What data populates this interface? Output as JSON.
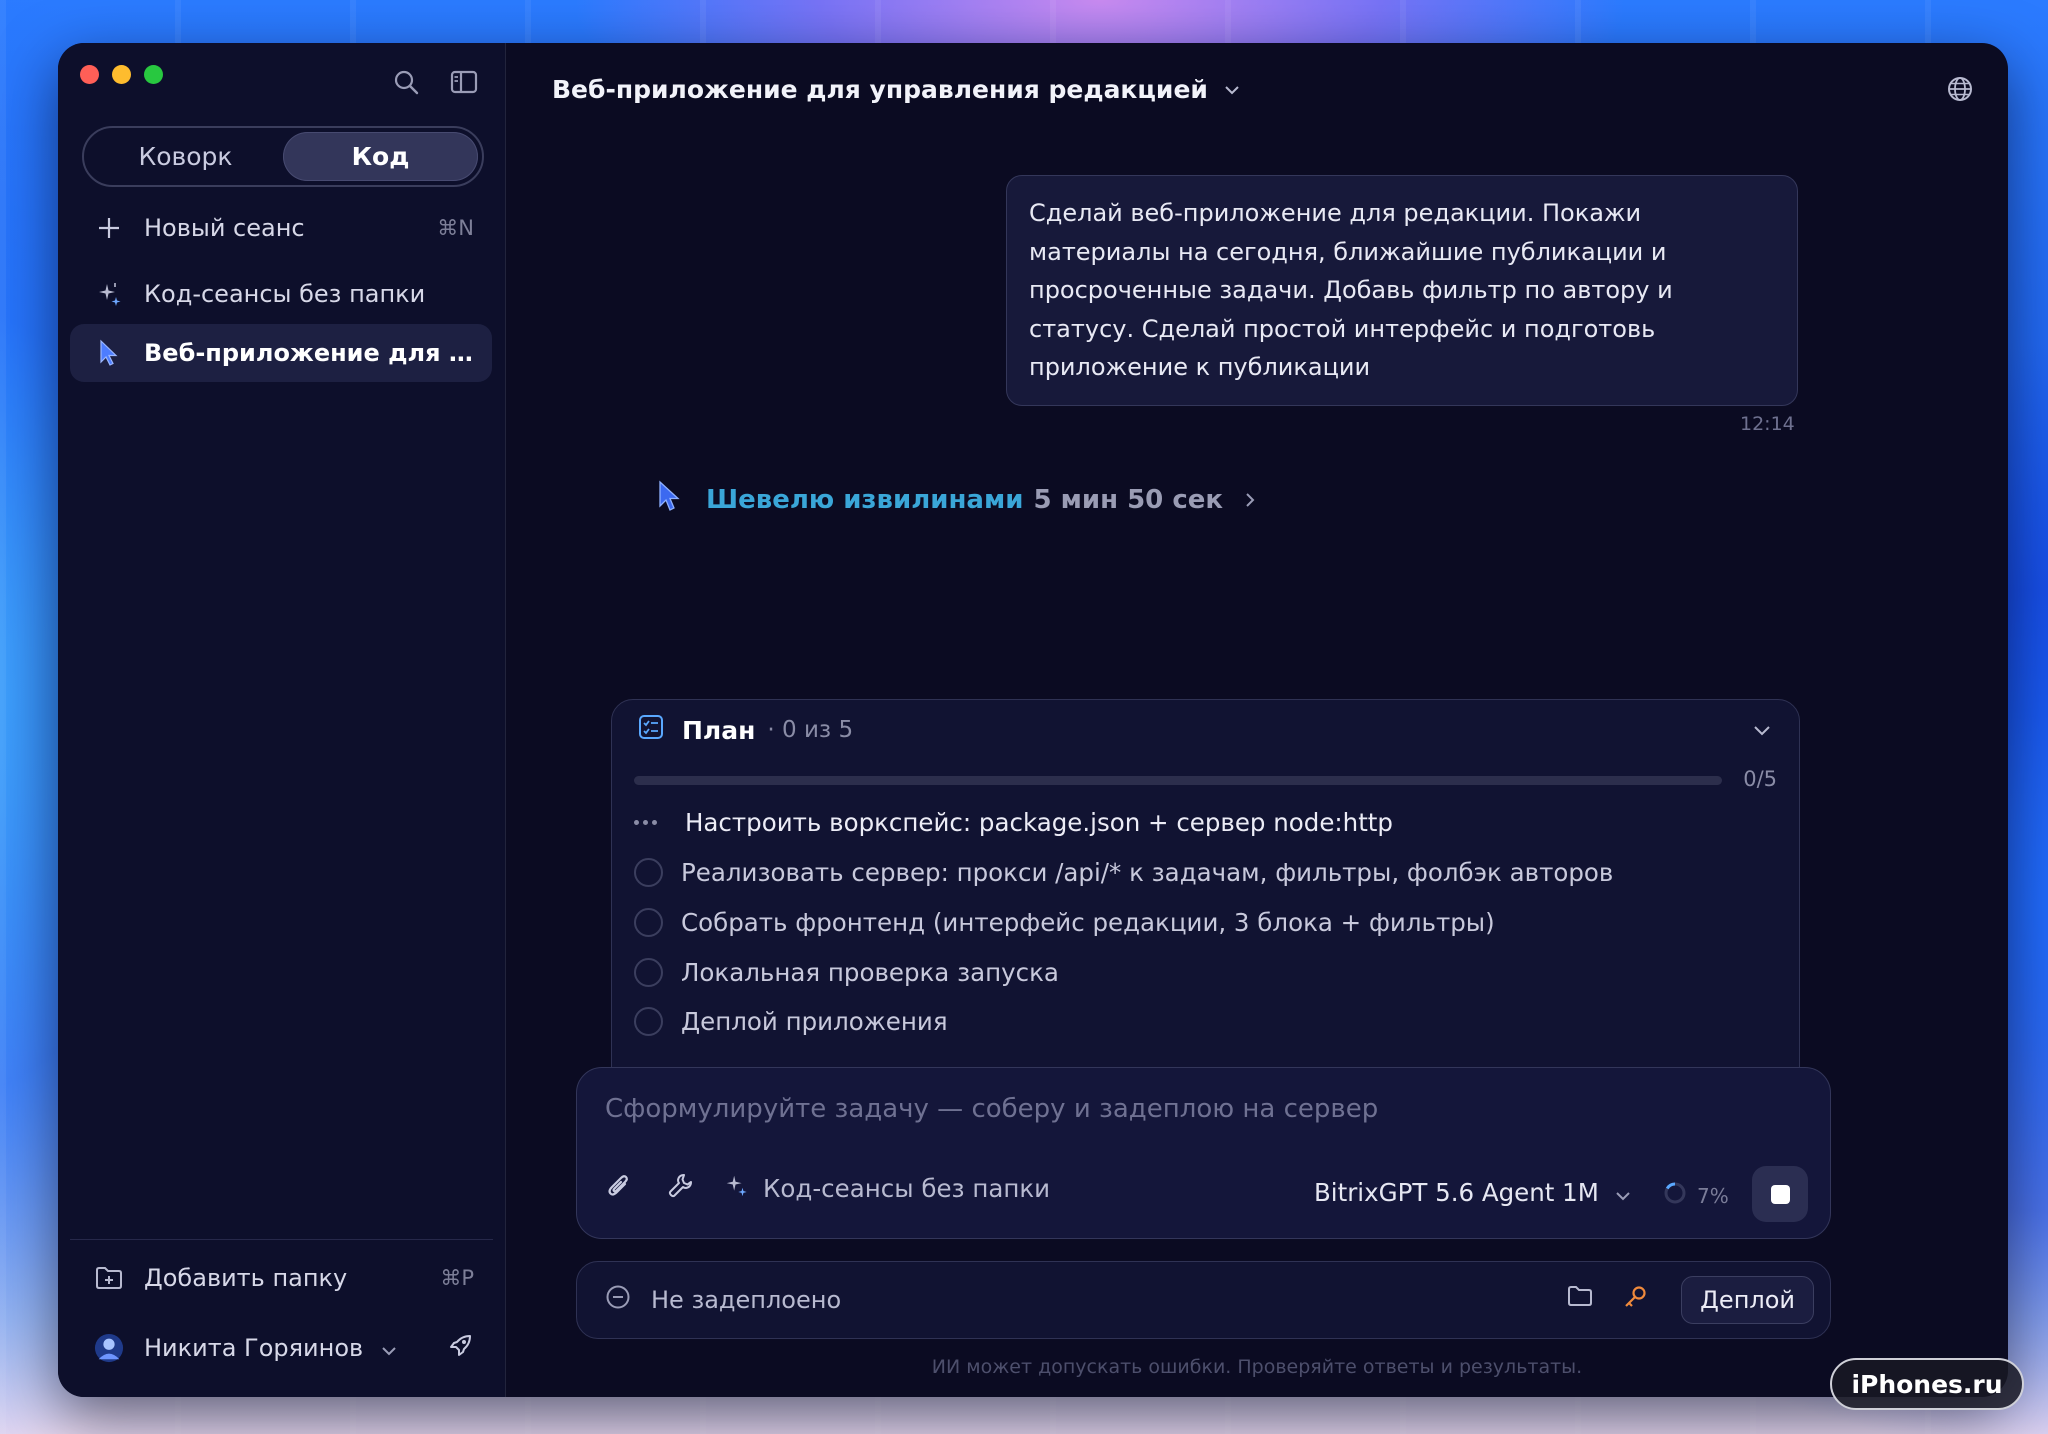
{
  "sidebar": {
    "segments": [
      "Коворк",
      "Код"
    ],
    "active_segment": "Код",
    "new_session": {
      "label": "Новый сеанс",
      "shortcut": "⌘N"
    },
    "items": [
      {
        "label": "Код-сеансы без папки",
        "icon": "sparkle-icon"
      },
      {
        "label": "Веб-приложение для упр...",
        "icon": "cursor-icon",
        "active": true
      }
    ],
    "add_folder": {
      "label": "Добавить папку",
      "shortcut": "⌘P"
    },
    "user": {
      "name": "Никита Горяинов"
    }
  },
  "header": {
    "title": "Веб-приложение для управления редакцией"
  },
  "chat": {
    "message": "Сделай веб-приложение для редакции. Покажи материалы на сегодня, ближайшие публикации и просроченные задачи. Добавь фильтр по автору и статусу. Сделай простой интерфейс и подготовь приложение к публикации",
    "time": "12:14",
    "thinking": {
      "label": "Шевелю извилинами",
      "duration": "5 мин 50 сек"
    }
  },
  "plan": {
    "title": "План",
    "count": "· 0 из 5",
    "progress_label": "0/5",
    "progress": 0,
    "tasks": [
      {
        "label": "Настроить воркспейс: package.json + сервер node:http",
        "state": "in-progress"
      },
      {
        "label": "Реализовать сервер: прокси /api/* к задачам, фильтры, фолбэк авторов",
        "state": "pending"
      },
      {
        "label": "Собрать фронтенд (интерфейс редакции, 3 блока + фильтры)",
        "state": "pending"
      },
      {
        "label": "Локальная проверка запуска",
        "state": "pending"
      },
      {
        "label": "Деплой приложения",
        "state": "pending"
      }
    ]
  },
  "composer": {
    "placeholder": "Сформулируйте задачу — соберу и задеплою на сервер",
    "folder": "Код-сеансы без папки",
    "model": "BitrixGPT 5.6 Agent 1M",
    "context": "7%"
  },
  "deploy": {
    "status": "Не задеплоено",
    "button": "Деплой"
  },
  "disclaimer": "ИИ может допускать ошибки. Проверяйте ответы и результаты.",
  "watermark": "iPhones.ru",
  "colors": {
    "accent": "#3aa6d8",
    "background": "#0b0b22",
    "sidebar": "#0d0f2b"
  }
}
